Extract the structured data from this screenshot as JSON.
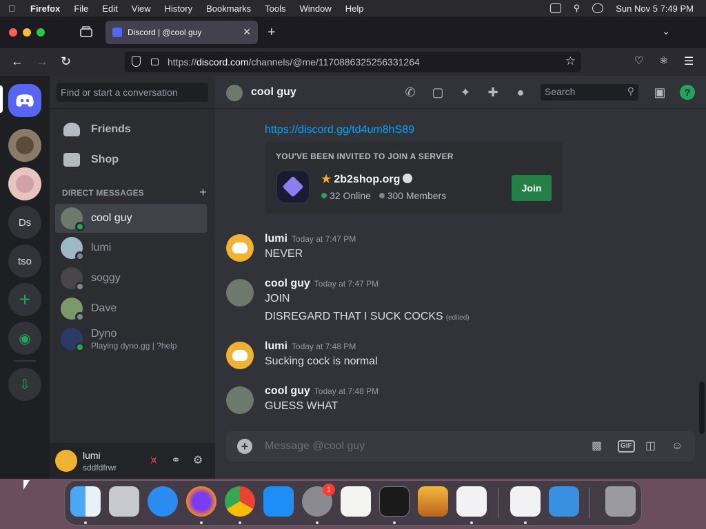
{
  "menubar": {
    "app": "Firefox",
    "items": [
      "File",
      "Edit",
      "View",
      "History",
      "Bookmarks",
      "Tools",
      "Window",
      "Help"
    ],
    "clock": "Sun Nov 5  7:49 PM"
  },
  "browser": {
    "tab_title": "Discord | @cool guy",
    "url_prefix": "https://",
    "url_host": "discord.com",
    "url_path": "/channels/@me/1170886325256331264"
  },
  "guilds": {
    "items": [
      "Ds",
      "tso"
    ]
  },
  "sidebar": {
    "search_placeholder": "Find or start a conversation",
    "friends_label": "Friends",
    "shop_label": "Shop",
    "dm_header": "DIRECT MESSAGES",
    "dms": [
      {
        "name": "cool guy",
        "sub": "",
        "status": "online"
      },
      {
        "name": "lumi",
        "sub": "",
        "status": "offline"
      },
      {
        "name": "soggy",
        "sub": "",
        "status": "offline"
      },
      {
        "name": "Dave",
        "sub": "",
        "status": "offline"
      },
      {
        "name": "Dyno",
        "sub": "Playing dyno.gg | ?help",
        "status": "online"
      }
    ]
  },
  "user_panel": {
    "name": "lumi",
    "tag": "sddfdfrwr"
  },
  "chat": {
    "channel_name": "cool guy",
    "search_placeholder": "Search",
    "help_glyph": "?",
    "invite_link": "https://discord.gg/td4um8hS89",
    "invite": {
      "title": "YOU'VE BEEN INVITED TO JOIN A SERVER",
      "server_name": "2b2shop.org",
      "online": "32 Online",
      "members": "300 Members",
      "join_label": "Join"
    },
    "messages": [
      {
        "author": "lumi",
        "time": "Today at 7:47 PM",
        "lines": [
          "NEVER"
        ]
      },
      {
        "author": "cool guy",
        "time": "Today at 7:47 PM",
        "lines": [
          "JOIN",
          "DISREGARD THAT I SUCK COCKS"
        ],
        "edited": "(edited)"
      },
      {
        "author": "lumi",
        "time": "Today at 7:48 PM",
        "lines": [
          "Sucking cock is normal"
        ]
      },
      {
        "author": "cool guy",
        "time": "Today at 7:48 PM",
        "lines": [
          "GUESS WHAT"
        ]
      }
    ],
    "composer_placeholder": "Message @cool guy",
    "gif_label": "GIF"
  },
  "dock": {
    "badge_count": "1"
  },
  "colors": {
    "blurple": "#5865f2",
    "green": "#23a559",
    "link": "#00a8fc",
    "lumi_avatar": "#f0b232"
  }
}
